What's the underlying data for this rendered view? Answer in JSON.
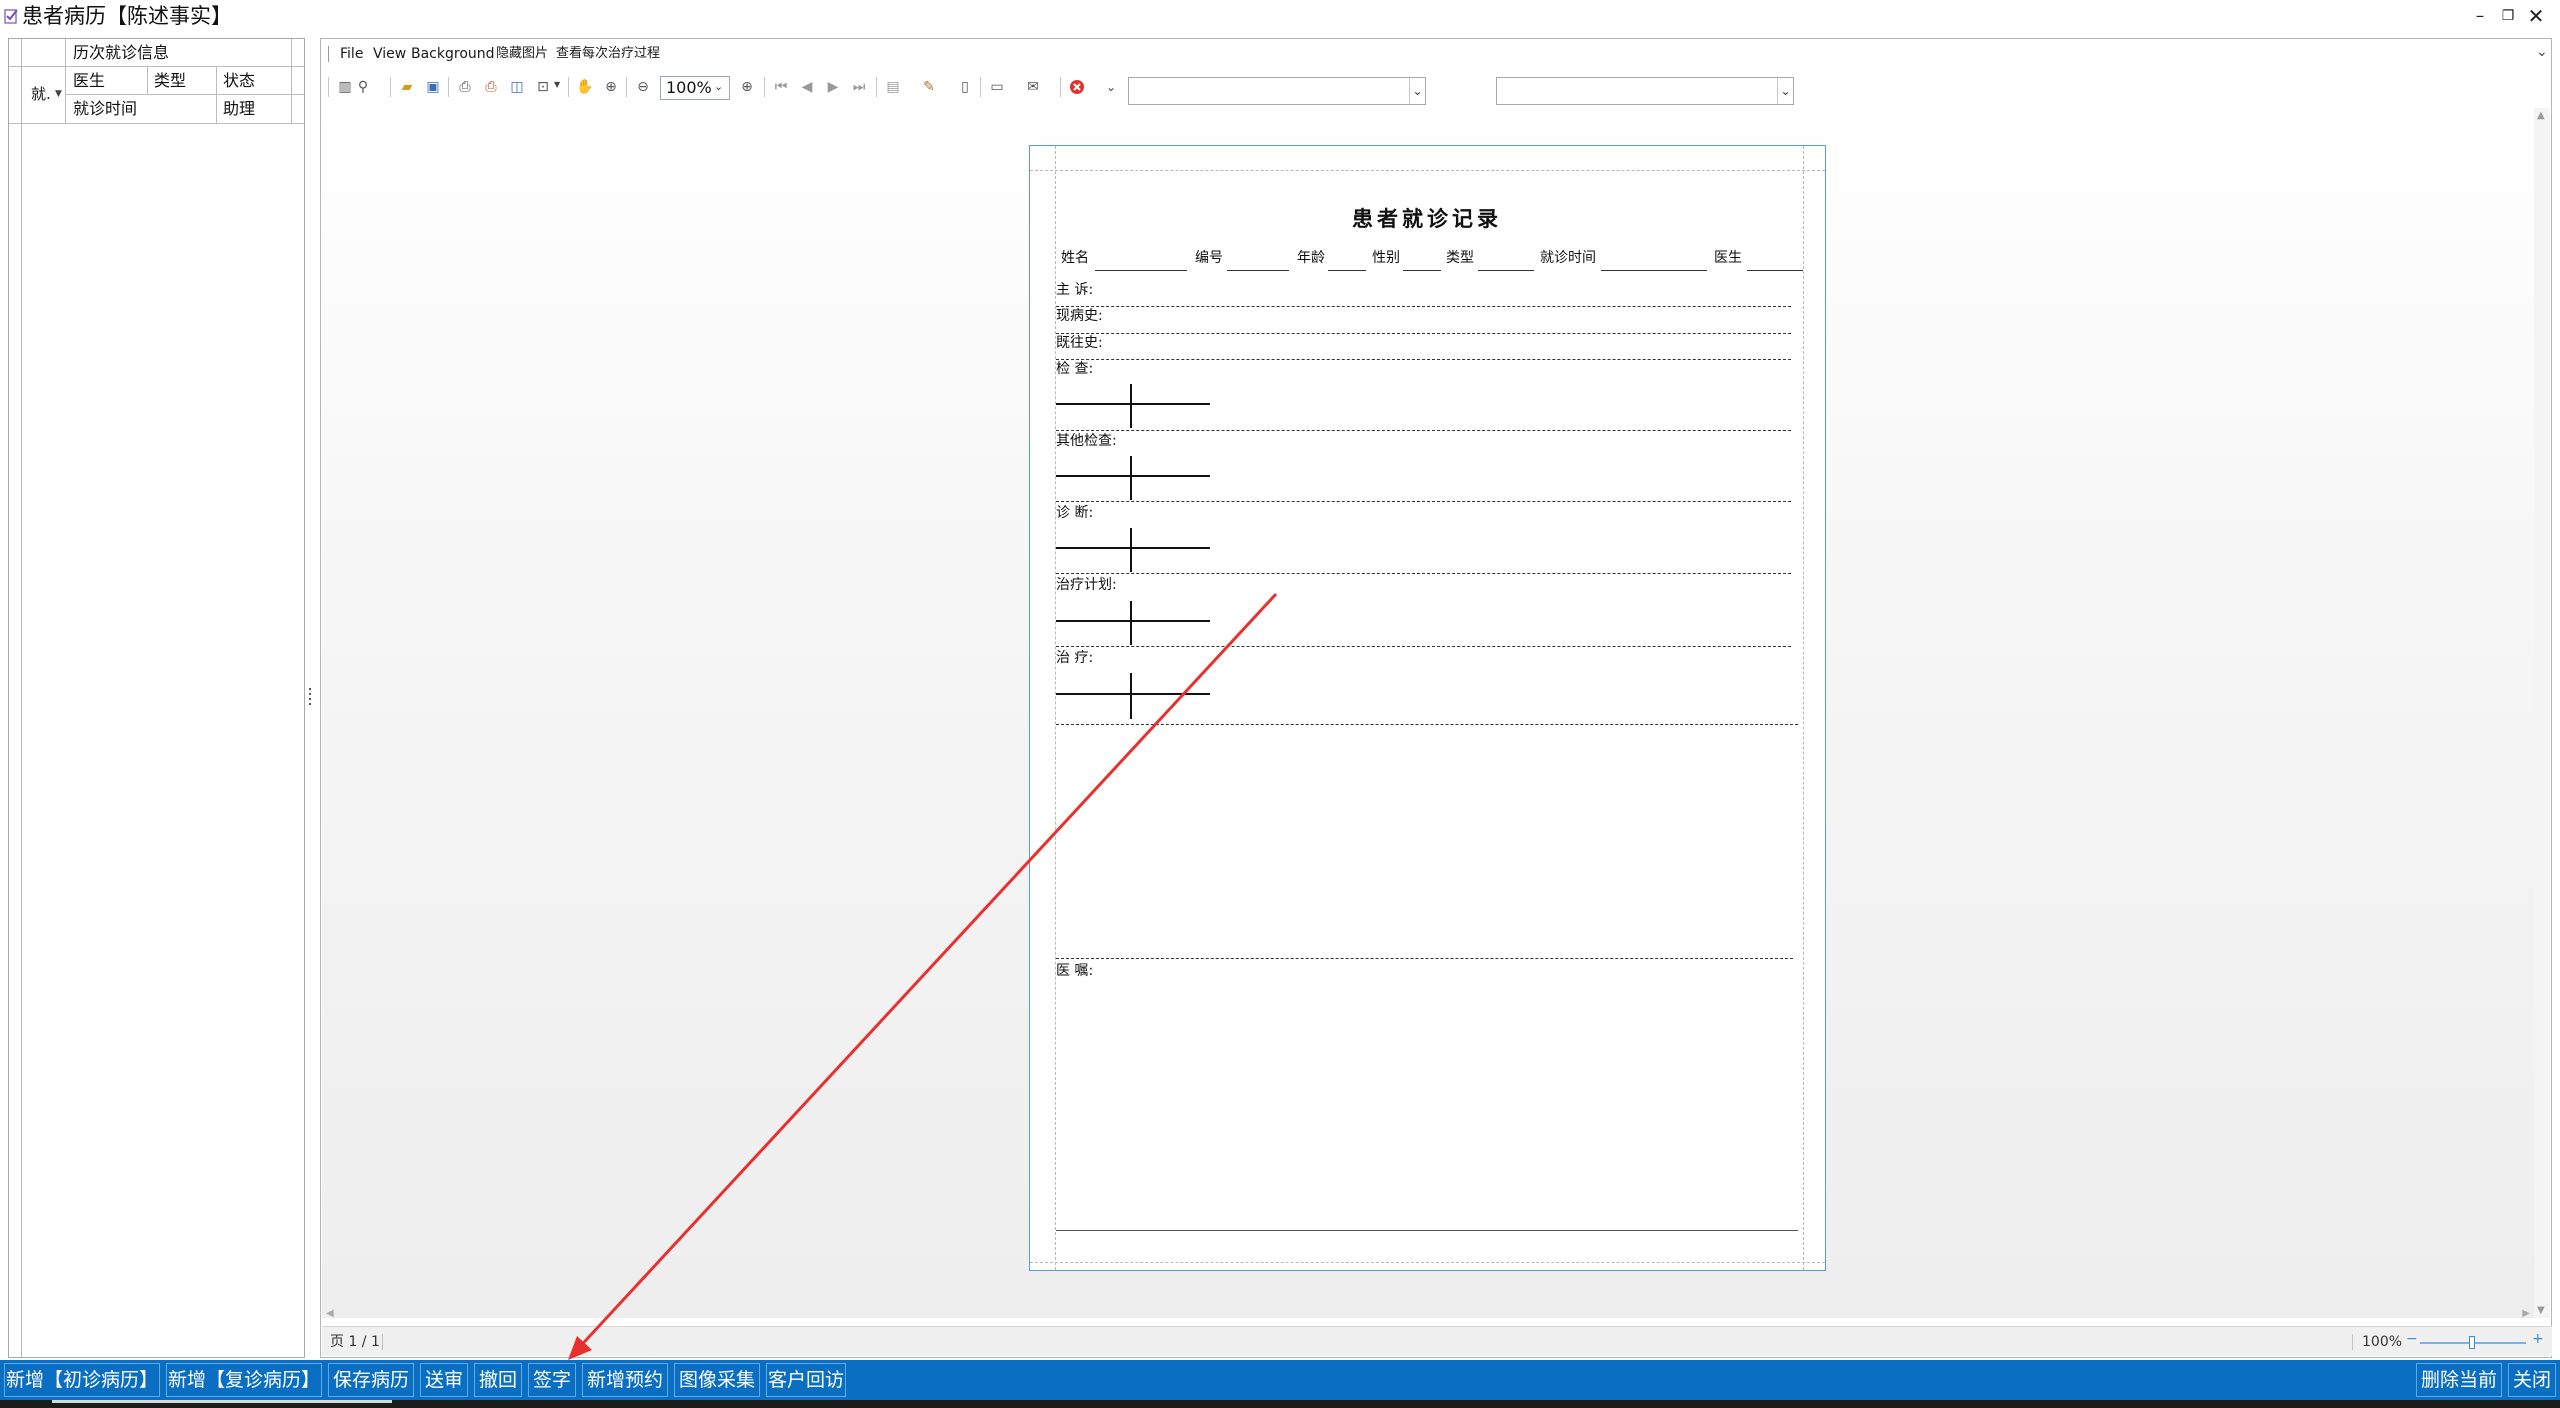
{
  "window": {
    "title": "患者病历【陈述事实】",
    "controls": [
      "minimize",
      "restore",
      "close"
    ]
  },
  "history_panel": {
    "header": "历次就诊信息",
    "group_label": "就.",
    "columns_row1": [
      "医生",
      "类型",
      "状态"
    ],
    "columns_row2": [
      "就诊时间",
      "助理"
    ]
  },
  "viewer": {
    "menu": [
      "File",
      "View",
      "Background",
      "隐藏图片",
      "查看每次治疗过程"
    ],
    "zoom": "100%",
    "toolbar_icons": [
      "layout-icon",
      "find-icon",
      "open-icon",
      "save-icon",
      "print-icon",
      "quick-print-icon",
      "page-setup-icon",
      "scale-icon",
      "hand-tool-icon",
      "magnifier-icon",
      "zoom-out-icon",
      "zoom-in-icon",
      "first-page-icon",
      "prev-page-icon",
      "next-page-icon",
      "last-page-icon",
      "multi-page-icon",
      "color-icon",
      "watermark-icon",
      "export-icon",
      "send-icon",
      "close-preview-icon"
    ],
    "combo1": "",
    "combo2": ""
  },
  "document": {
    "title": "患者就诊记录",
    "header_fields": [
      "姓名",
      "编号",
      "年龄",
      "性别",
      "类型",
      "就诊时间",
      "医生"
    ],
    "sections": [
      "主  诉:",
      "现病史:",
      "既往史:",
      "检  查:",
      "其他检查:",
      "诊    断:",
      "治疗计划:",
      "治    疗:",
      "医  嘱:"
    ]
  },
  "statusbar": {
    "page": "页 1 / 1",
    "zoom": "100%"
  },
  "bottom_buttons": {
    "new_initial": "新增【初诊病历】",
    "new_followup": "新增【复诊病历】",
    "save": "保存病历",
    "submit": "送审",
    "revoke": "撤回",
    "sign": "签字",
    "new_appointment": "新增预约",
    "image_capture": "图像采集",
    "customer_followup": "客户回访",
    "delete_current": "删除当前",
    "close": "关闭"
  },
  "colors": {
    "accent": "#0a6fc2",
    "page_border": "#5b9bd5",
    "annotation_arrow": "#e8302e"
  }
}
